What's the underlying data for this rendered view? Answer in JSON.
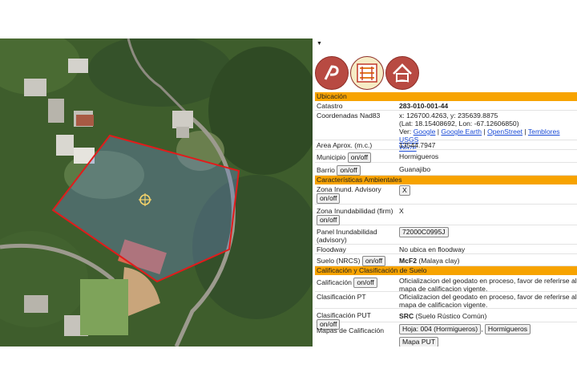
{
  "map": {
    "target_icon": "crosshair-icon"
  },
  "panel": {
    "collapse_icon": "caret-down-icon",
    "logos": [
      "geoportal-logo-icon",
      "crim-logo-icon",
      "housing-logo-icon"
    ],
    "sections": {
      "ubicacion": "Ubicación",
      "caracteristicas": "Características Ambientales",
      "calificacion": "Calificación y Clasificación de Suelo"
    },
    "catastro": {
      "label": "Catastro",
      "value": "283-010-001-44"
    },
    "coordenadas": {
      "label": "Coordenadas Nad83",
      "xy": "x: 126700.4263, y: 235639.8875",
      "latlon": "(Lat: 18.15408692, Lon: -67.12606850)",
      "ver": "Ver:",
      "links": [
        "Google",
        "Google Earth",
        "OpenStreet",
        "Temblores USGS",
        "Waze"
      ]
    },
    "area": {
      "label": "Area Aprox. (m.c.)",
      "value": "13544.7947"
    },
    "municipio": {
      "label": "Municipio",
      "toggle": "on/off",
      "value": "Hormigueros"
    },
    "barrio": {
      "label": "Barrio",
      "toggle": "on/off",
      "value": "Guanajibo"
    },
    "zona_advisory": {
      "label": "Zona Inund. Advisory",
      "toggle": "on/off",
      "value": "X"
    },
    "zona_firm": {
      "label": "Zona Inundabilidad (firm)",
      "toggle": "on/off",
      "value": "X"
    },
    "panel_inund": {
      "label": "Panel Inundabilidad (advisory)",
      "value": "72000C0995J"
    },
    "floodway": {
      "label": "Floodway",
      "value": "No ubica en floodway"
    },
    "suelo": {
      "label": "Suelo (NRCS)",
      "toggle": "on/off",
      "code": "McF2",
      "desc": " (Malaya clay)"
    },
    "calificacion": {
      "label": "Calificación",
      "toggle": "on/off",
      "value": "Oficializacion del geodato en proceso, favor de referirse al mapa de calificacion vigente."
    },
    "clasificacion_pt": {
      "label": "Clasificación PT",
      "value": "Oficializacion del geodato en proceso, favor de referirse al mapa de calificacion vigente."
    },
    "clasificacion_put": {
      "label": "Clasificación PUT",
      "toggle": "on/off",
      "code": "SRC",
      "desc": " (Suelo Rústico Común)"
    },
    "mapas": {
      "label": "Mapas de Calificación",
      "hoja": "Hoja: 004 (Hormigueros)",
      "sep": ",",
      "municipio": "Hormigueros",
      "put": "Mapa PUT"
    }
  }
}
